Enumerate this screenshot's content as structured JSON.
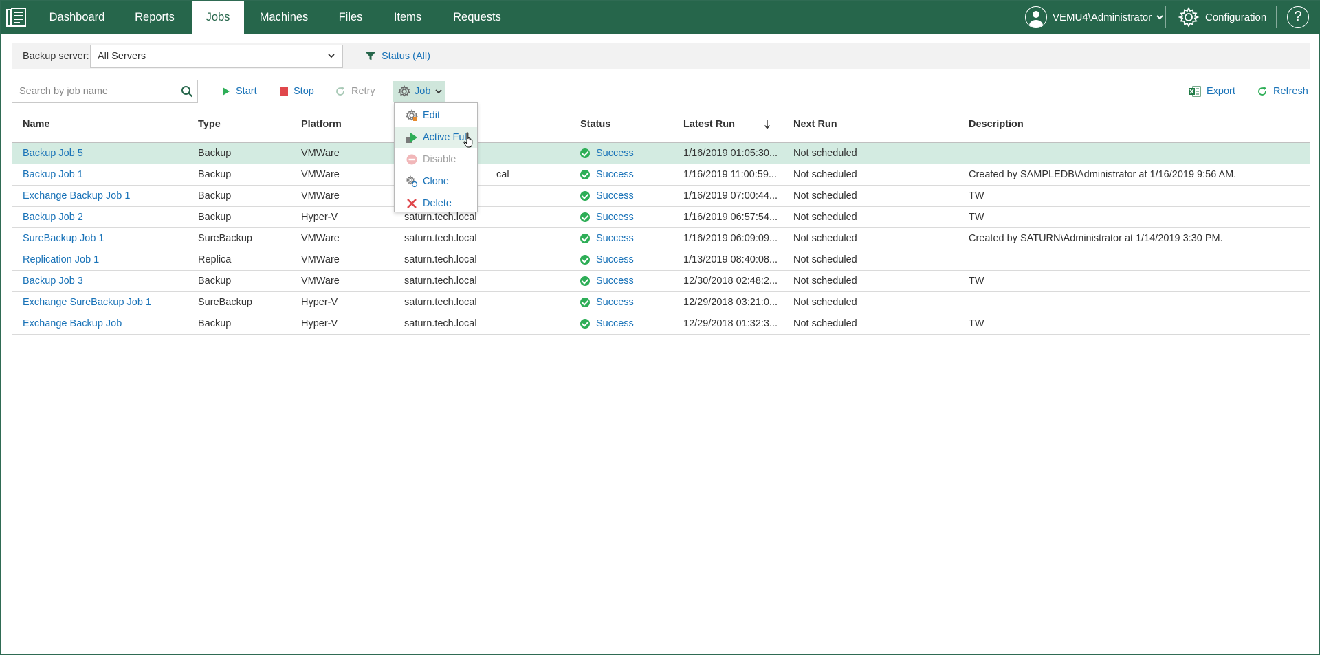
{
  "nav": {
    "tabs": [
      {
        "label": "Dashboard",
        "active": false
      },
      {
        "label": "Reports",
        "active": false
      },
      {
        "label": "Jobs",
        "active": true
      },
      {
        "label": "Machines",
        "active": false
      },
      {
        "label": "Files",
        "active": false
      },
      {
        "label": "Items",
        "active": false
      },
      {
        "label": "Requests",
        "active": false
      }
    ],
    "user": "VEMU4\\Administrator",
    "configuration": "Configuration",
    "help": "?"
  },
  "filter": {
    "backup_server_label": "Backup server:",
    "backup_server_value": "All Servers",
    "status_filter": "Status (All)"
  },
  "toolbar": {
    "search_placeholder": "Search by job name",
    "start": "Start",
    "stop": "Stop",
    "retry": "Retry",
    "job": "Job",
    "export": "Export",
    "refresh": "Refresh"
  },
  "job_menu": {
    "items": [
      {
        "label": "Edit",
        "enabled": true
      },
      {
        "label": "Active Full",
        "enabled": true
      },
      {
        "label": "Disable",
        "enabled": false
      },
      {
        "label": "Clone",
        "enabled": true
      },
      {
        "label": "Delete",
        "enabled": true
      }
    ]
  },
  "table": {
    "columns": [
      "Name",
      "Type",
      "Platform",
      "",
      "Status",
      "Latest Run",
      "Next Run",
      "Description"
    ],
    "rows": [
      {
        "name": "Backup Job 5",
        "type": "Backup",
        "platform": "VMWare",
        "server": "",
        "status": "Success",
        "latest_run": "1/16/2019 01:05:30...",
        "next_run": "Not scheduled",
        "description": "",
        "selected": true
      },
      {
        "name": "Backup Job 1",
        "type": "Backup",
        "platform": "VMWare",
        "server": "cal",
        "status": "Success",
        "latest_run": "1/16/2019 11:00:59...",
        "next_run": "Not scheduled",
        "description": "Created by SAMPLEDB\\Administrator at 1/16/2019 9:56 AM.",
        "selected": false
      },
      {
        "name": "Exchange Backup Job 1",
        "type": "Backup",
        "platform": "VMWare",
        "server": "",
        "status": "Success",
        "latest_run": "1/16/2019 07:00:44...",
        "next_run": "Not scheduled",
        "description": "TW",
        "selected": false
      },
      {
        "name": "Backup Job 2",
        "type": "Backup",
        "platform": "Hyper-V",
        "server": "saturn.tech.local",
        "status": "Success",
        "latest_run": "1/16/2019 06:57:54...",
        "next_run": "Not scheduled",
        "description": "TW",
        "selected": false
      },
      {
        "name": "SureBackup Job 1",
        "type": "SureBackup",
        "platform": "VMWare",
        "server": "saturn.tech.local",
        "status": "Success",
        "latest_run": "1/16/2019 06:09:09...",
        "next_run": "Not scheduled",
        "description": "Created by SATURN\\Administrator at 1/14/2019 3:30 PM.",
        "selected": false
      },
      {
        "name": "Replication Job 1",
        "type": "Replica",
        "platform": "VMWare",
        "server": "saturn.tech.local",
        "status": "Success",
        "latest_run": "1/13/2019 08:40:08...",
        "next_run": "Not scheduled",
        "description": "",
        "selected": false
      },
      {
        "name": "Backup Job 3",
        "type": "Backup",
        "platform": "VMWare",
        "server": "saturn.tech.local",
        "status": "Success",
        "latest_run": "12/30/2018 02:48:2...",
        "next_run": "Not scheduled",
        "description": "TW",
        "selected": false
      },
      {
        "name": "Exchange SureBackup Job 1",
        "type": "SureBackup",
        "platform": "Hyper-V",
        "server": "saturn.tech.local",
        "status": "Success",
        "latest_run": "12/29/2018 03:21:0...",
        "next_run": "Not scheduled",
        "description": "",
        "selected": false
      },
      {
        "name": "Exchange Backup Job",
        "type": "Backup",
        "platform": "Hyper-V",
        "server": "saturn.tech.local",
        "status": "Success",
        "latest_run": "12/29/2018 01:32:3...",
        "next_run": "Not scheduled",
        "description": "TW",
        "selected": false
      }
    ]
  },
  "colors": {
    "brand": "#26664b",
    "link": "#1a73b8",
    "selected_row": "#d3ebe1",
    "success": "#2eae57",
    "stop": "#e0474c",
    "delete": "#e0474c"
  }
}
